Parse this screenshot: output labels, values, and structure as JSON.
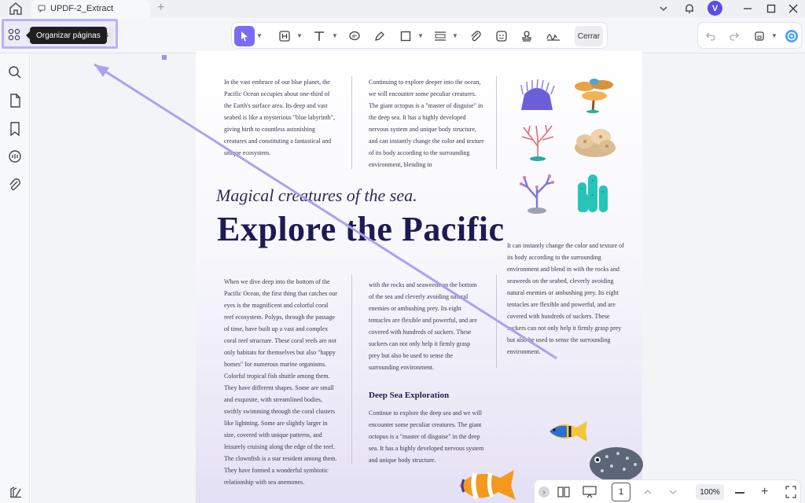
{
  "titlebar": {
    "tab_title": "UPDF-2_Extract",
    "avatar_letter": "V"
  },
  "toolbar": {
    "organize_tooltip": "Organizar páginas",
    "organize_partial": "as",
    "close_label": "Cerrar"
  },
  "document": {
    "col1_top": "In the vast embrace of our blue planet, the Pacific Ocean occupies about one-third of the Earth's surface area. Its deep and vast seabed is like a mysterious \"blue labyrinth\", giving birth to countless astonishing creatures and constituting a fantastical and unique ecosystem.",
    "col2_top": "Continuing to explore deeper into the ocean, we will encounter some peculiar creatures. The giant octopus is a \"master of disguise\" in the deep sea. It has a highly developed nervous system and unique body structure, and can instantly change the color and texture of its body according to the surrounding environment, blending in",
    "subtitle": "Magical creatures of the sea.",
    "headline": "Explore the Pacific",
    "col3_right": "It can instantly change the color and texture of its body according to the surrounding environment and blend in with the rocks and seaweeds on the seabed, cleverly avoiding natural enemies or ambushing prey. Its eight tentacles are flexible and powerful, and are covered with hundreds of suckers. These suckers can not only help it firmly grasp prey but also be used to sense the surrounding environment.",
    "col1_bottom": "When we dive deep into the bottom of the Pacific Ocean, the first thing that catches our eyes is the magnificent and colorful coral reef ecosystem. Polyps, through the passage of time, have built up a vast and complex coral reef structure. These coral reefs are not only habitats for themselves but also \"happy homes\" for numerous marine organisms. Colorful tropical fish shuttle among them. They have different shapes. Some are small and exquisite, with streamlined bodies, swiftly swimming through the coral clusters like lightning. Some are slightly larger in size, covered with unique patterns, and leisurely cruising along the edge of the reef. The clownfish is a star resident among them. They have formed a wonderful symbiotic relationship with sea anemones.",
    "col2_bottom": "with the rocks and seaweeds on the bottom of the sea and cleverly avoiding natural enemies or ambushing prey. Its eight tentacles are flexible and powerful, and are covered with hundreds of suckers. These suckers can not only help it firmly grasp prey but also be used to sense the surrounding environment.",
    "section_heading": "Deep Sea Exploration",
    "section_text": "Continue to explore the deep sea and we will encounter some peculiar creatures. The giant octopus is a \"master of disguise\" in the deep sea. It has a highly developed nervous system and unique body structure."
  },
  "bottombar": {
    "page_number": "1",
    "zoom": "100%"
  },
  "colors": {
    "accent": "#7b6cf6",
    "highlight": "#b8b3f3",
    "text_dark": "#1e1b52"
  }
}
